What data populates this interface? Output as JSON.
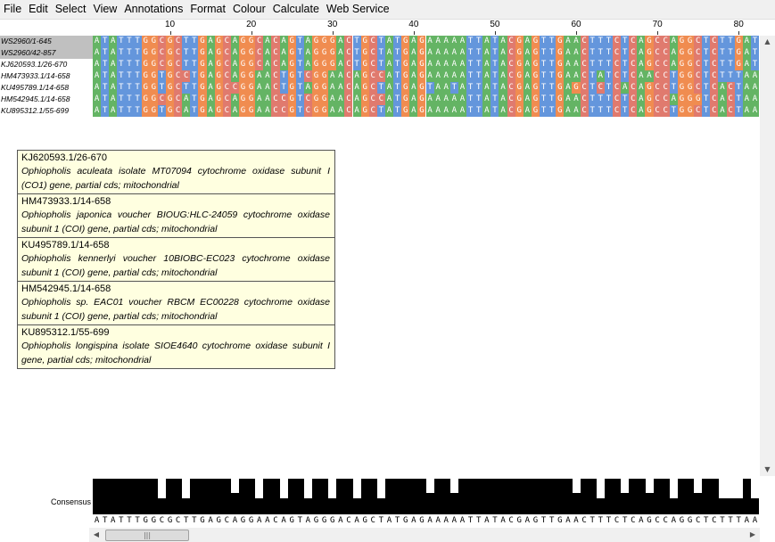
{
  "menu": [
    "File",
    "Edit",
    "Select",
    "View",
    "Annotations",
    "Format",
    "Colour",
    "Calculate",
    "Web Service"
  ],
  "ruler": {
    "labels": [
      "10",
      "20",
      "30",
      "40",
      "50",
      "60",
      "70",
      "80"
    ]
  },
  "sequences": [
    {
      "name": "WS2960/1-645",
      "selected": true,
      "seq": "ATATTTGGCGCTTGAGCAGGCACAGTAGGGACTGCTATGAGAAAAATTATACGAGTTGAACTTTCTCAGCCAGGCTCTTGAT"
    },
    {
      "name": "WS2960/42-857",
      "selected": true,
      "seq": "ATATTTGGCGCTTGAGCAGGCACAGTAGGGACTGCTATGAGAAAAATTATACGAGTTGAACTTTCTCAGCCAGGCTCTTGAT"
    },
    {
      "name": "KJ620593.1/26-670",
      "selected": false,
      "seq": "ATATTTGGCGCTTGAGCAGGCACAGTAGGGACTGCTATGAGAAAAATTATACGAGTTGAACTTTCTCAGCCAGGCTCTTGAT"
    },
    {
      "name": "HM473933.1/14-658",
      "selected": false,
      "seq": "ATATTTGGTGCCTGAGCAGGAACTGTCGGAACAGCCATGAGAAAAATTATACGAGTTGAACTATCTCAACCTGGCTCTTTAAT"
    },
    {
      "name": "KU495789.1/14-658",
      "selected": false,
      "seq": "ATATTTGGTGCTTGAGCCGGAACTGTAGGAACAGCTATGAGTAATATTATACGAGTTGAGCTCTCACAGCCTGGCTCACTAAT"
    },
    {
      "name": "HM542945.1/14-658",
      "selected": false,
      "seq": "ATATTTGGCGCATGAGCAGGAACCGTCGGAACAGCCATGAGAAAAATTATACGAGTTGAACTTTCTCAGCCAGGGTCACTAAT"
    },
    {
      "name": "KU895312.1/55-699",
      "selected": false,
      "seq": "ATATTTGGTGCATGAGCAGGAACCGTCGGAACAGCTATGAGAAAAATTATACGAGTTGAACTTTCTCAGCCTGGCTCACTAAT"
    }
  ],
  "tooltip": [
    {
      "id": "KJ620593.1/26-670",
      "desc": "Ophiopholis aculeata isolate MT07094 cytochrome oxidase subunit I (CO1) gene, partial cds; mitochondrial"
    },
    {
      "id": "HM473933.1/14-658",
      "desc": "Ophiopholis japonica voucher BIOUG:HLC-24059 cytochrome oxidase subunit 1 (COI) gene, partial cds; mitochondrial"
    },
    {
      "id": "KU495789.1/14-658",
      "desc": "Ophiopholis kennerlyi voucher 10BIOBC-EC023 cytochrome oxidase subunit 1 (COI) gene, partial cds; mitochondrial"
    },
    {
      "id": "HM542945.1/14-658",
      "desc": "Ophiopholis sp. EAC01 voucher RBCM EC00228 cytochrome oxidase subunit 1 (COI) gene, partial cds; mitochondrial"
    },
    {
      "id": "KU895312.1/55-699",
      "desc": "Ophiopholis longispina isolate SIOE4640 cytochrome oxidase subunit I gene, partial cds; mitochondrial"
    }
  ],
  "consensus": {
    "label": "Consensus",
    "seq": "ATATTTGGCGCTTGAGCAGGAACAGTAGGGACAGCTATGAGAAAAATTATACGAGTTGAACTTTCTCAGCCAGGCTCTTTAAT"
  },
  "colors": {
    "A": "#64b464",
    "T": "#6496dc",
    "G": "#f08c50",
    "C": "#e07a6e",
    "blank": "#ffffff"
  },
  "icons": {
    "scroll_up": "triangle-up",
    "scroll_down": "triangle-down",
    "scroll_left": "triangle-left",
    "scroll_right": "triangle-right"
  }
}
